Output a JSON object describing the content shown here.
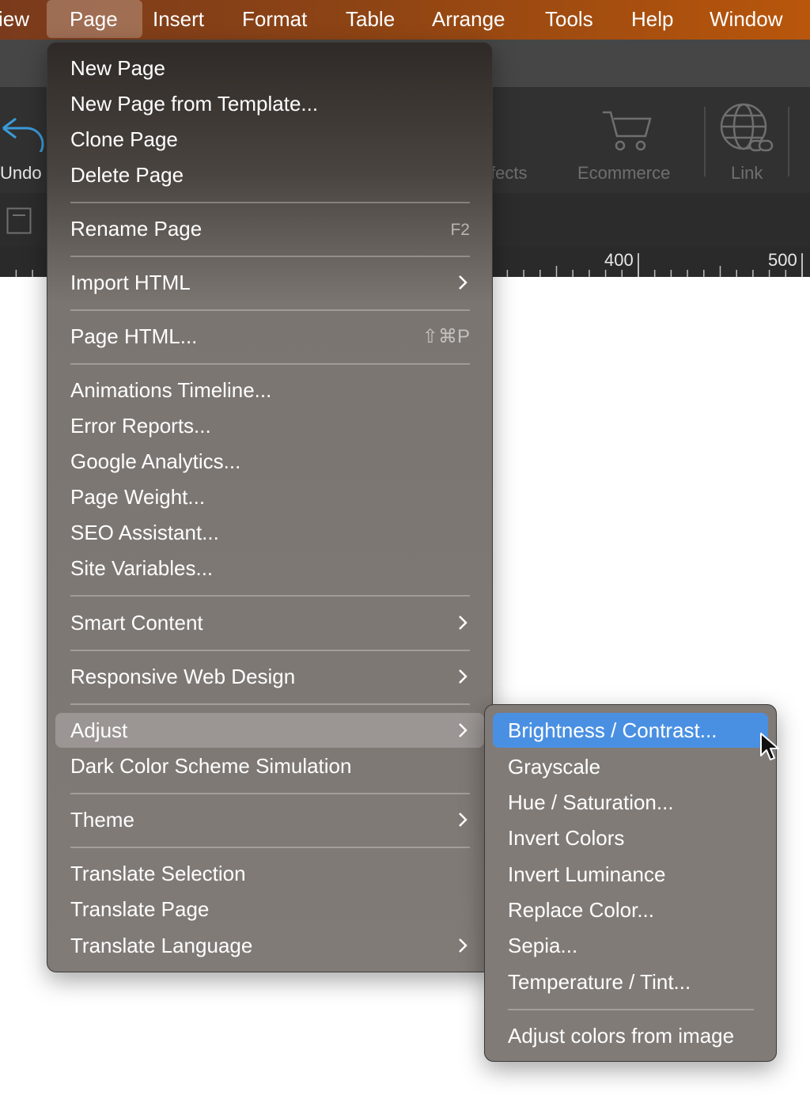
{
  "menubar": {
    "items": [
      "iew",
      "Page",
      "Insert",
      "Format",
      "Table",
      "Arrange",
      "Tools",
      "Help",
      "Window"
    ],
    "active_index": 1
  },
  "toolbar": {
    "undo_label": "Undo",
    "effects_label": "fects",
    "ecommerce_label": "Ecommerce",
    "link_label": "Link"
  },
  "ruler": {
    "mark_400": "400",
    "mark_500": "500"
  },
  "page_menu": {
    "new_page": "New Page",
    "new_page_template": "New Page from Template...",
    "clone_page": "Clone Page",
    "delete_page": "Delete Page",
    "rename_page": "Rename Page",
    "rename_shortcut": "F2",
    "import_html": "Import HTML",
    "page_html": "Page HTML...",
    "page_html_shortcut": "⇧⌘P",
    "animations_timeline": "Animations Timeline...",
    "error_reports": "Error Reports...",
    "google_analytics": "Google Analytics...",
    "page_weight": "Page Weight...",
    "seo_assistant": "SEO Assistant...",
    "site_variables": "Site Variables...",
    "smart_content": "Smart Content",
    "responsive_web_design": "Responsive Web Design",
    "adjust": "Adjust",
    "dark_color_scheme": "Dark Color Scheme Simulation",
    "theme": "Theme",
    "translate_selection": "Translate Selection",
    "translate_page": "Translate Page",
    "translate_language": "Translate Language"
  },
  "adjust_submenu": {
    "brightness_contrast": "Brightness / Contrast...",
    "grayscale": "Grayscale",
    "hue_saturation": "Hue / Saturation...",
    "invert_colors": "Invert Colors",
    "invert_luminance": "Invert Luminance",
    "replace_color": "Replace Color...",
    "sepia": "Sepia...",
    "temperature_tint": "Temperature / Tint...",
    "adjust_from_image": "Adjust colors from image"
  },
  "colors": {
    "menubar_start": "#7a3b1c",
    "menubar_end": "#b8560c",
    "highlight": "#4a90e2",
    "undo_accent": "#3a9ad9"
  }
}
